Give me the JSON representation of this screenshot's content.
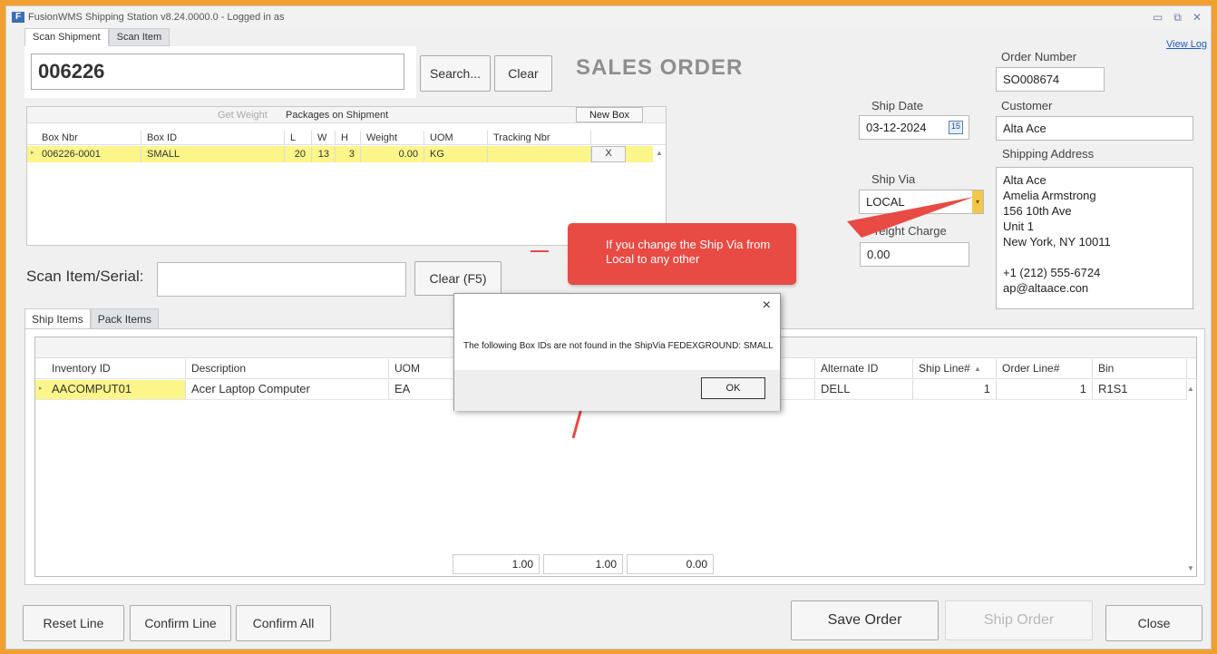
{
  "app": {
    "title": "FusionWMS Shipping Station v8.24.0000.0 - Logged in as",
    "window_buttons": [
      "minimize-icon",
      "restore-icon",
      "close-icon"
    ]
  },
  "tabs_top": [
    {
      "label": "Scan Shipment",
      "active": true
    },
    {
      "label": "Scan Item",
      "active": false
    }
  ],
  "shipment": {
    "value": "006226",
    "search_label": "Search...",
    "clear_label": "Clear"
  },
  "heading": "SALES ORDER",
  "view_log": "View Log",
  "order": {
    "number_label": "Order Number",
    "number": "SO008674",
    "customer_label": "Customer",
    "customer": "Alta Ace",
    "address_label": "Shipping Address",
    "address_lines": [
      "Alta Ace",
      "Amelia Armstrong",
      "156 10th Ave",
      "Unit 1",
      "New York, NY  10011",
      "",
      "+1 (212) 555-6724",
      "ap@altaace.con"
    ]
  },
  "ship": {
    "date_label": "Ship Date",
    "date": "03-12-2024",
    "via_label": "Ship Via",
    "via": "LOCAL",
    "freight_label": "Freight Charge",
    "freight": "0.00"
  },
  "packages": {
    "get_weight": "Get Weight",
    "caption": "Packages on Shipment",
    "new_box": "New Box",
    "columns": [
      "Box Nbr",
      "Box ID",
      "L",
      "W",
      "H",
      "Weight",
      "UOM",
      "Tracking Nbr"
    ],
    "rows": [
      {
        "box_nbr": "006226-0001",
        "box_id": "SMALL",
        "l": "20",
        "w": "13",
        "h": "3",
        "weight": "0.00",
        "uom": "KG",
        "tracking": "",
        "delete": "X"
      }
    ]
  },
  "scan": {
    "label": "Scan Item/Serial:",
    "value": "",
    "clear_label": "Clear (F5)"
  },
  "tabs_items": [
    {
      "label": "Ship Items",
      "active": true
    },
    {
      "label": "Pack Items",
      "active": false
    }
  ],
  "items": {
    "columns": [
      "Inventory ID",
      "Description",
      "UOM",
      "Alternate ID",
      "Ship Line#",
      "Order Line#",
      "Bin"
    ],
    "rows": [
      {
        "inventory_id": "AACOMPUT01",
        "description": "Acer Laptop Computer",
        "uom": "EA",
        "alternate_id": "DELL",
        "ship_line": "1",
        "order_line": "1",
        "bin": "R1S1"
      }
    ],
    "totals": [
      "1.00",
      "1.00",
      "0.00"
    ]
  },
  "buttons": {
    "reset_line": "Reset Line",
    "confirm_line": "Confirm Line",
    "confirm_all": "Confirm All",
    "save_order": "Save Order",
    "ship_order": "Ship Order",
    "close": "Close"
  },
  "callout": "If you change the Ship Via from Local to any other",
  "dialog": {
    "message": "The following Box IDs are not found in the ShipVia FEDEXGROUND: SMALL",
    "ok": "OK",
    "close": "×"
  },
  "colors": {
    "highlight": "#fbf58a",
    "callout": "#e84a44",
    "accent_orange": "#f0a030",
    "link": "#1a5cc8"
  }
}
